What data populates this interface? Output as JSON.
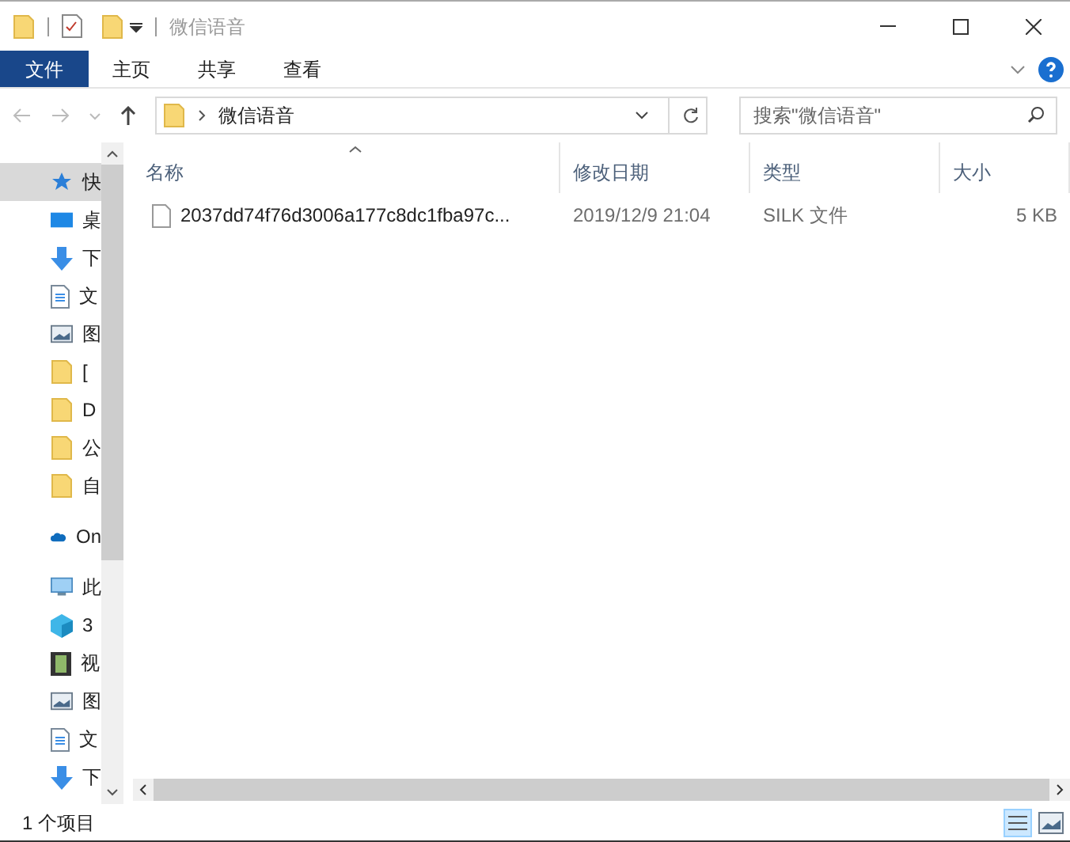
{
  "window": {
    "title": "微信语音"
  },
  "ribbon": {
    "tabs": [
      {
        "label": "文件",
        "selected": true
      },
      {
        "label": "主页",
        "selected": false
      },
      {
        "label": "共享",
        "selected": false
      },
      {
        "label": "查看",
        "selected": false
      }
    ]
  },
  "address": {
    "path": "微信语音",
    "search_placeholder": "搜索\"微信语音\""
  },
  "nav": [
    {
      "label": "快",
      "kind": "star",
      "selected": true
    },
    {
      "label": "桌",
      "kind": "desktop",
      "selected": false
    },
    {
      "label": "下",
      "kind": "download",
      "selected": false
    },
    {
      "label": "文",
      "kind": "doc",
      "selected": false
    },
    {
      "label": "图",
      "kind": "image",
      "selected": false
    },
    {
      "label": "[",
      "kind": "folder",
      "selected": false
    },
    {
      "label": "D",
      "kind": "folder",
      "selected": false
    },
    {
      "label": "公",
      "kind": "folder",
      "selected": false
    },
    {
      "label": "自",
      "kind": "folder",
      "selected": false
    },
    {
      "label": "On",
      "kind": "cloud",
      "selected": false
    },
    {
      "label": "此",
      "kind": "pc",
      "selected": false
    },
    {
      "label": "3",
      "kind": "cube",
      "selected": false
    },
    {
      "label": "视",
      "kind": "film",
      "selected": false
    },
    {
      "label": "图",
      "kind": "image",
      "selected": false
    },
    {
      "label": "文",
      "kind": "doc",
      "selected": false
    },
    {
      "label": "下",
      "kind": "download",
      "selected": false
    }
  ],
  "table": {
    "columns": [
      "名称",
      "修改日期",
      "类型",
      "大小"
    ],
    "rows": [
      {
        "name": "2037dd74f76d3006a177c8dc1fba97c...",
        "modified": "2019/12/9 21:04",
        "type": "SILK 文件",
        "size": "5 KB"
      }
    ]
  },
  "status_bar": {
    "count": "1 个项目"
  }
}
